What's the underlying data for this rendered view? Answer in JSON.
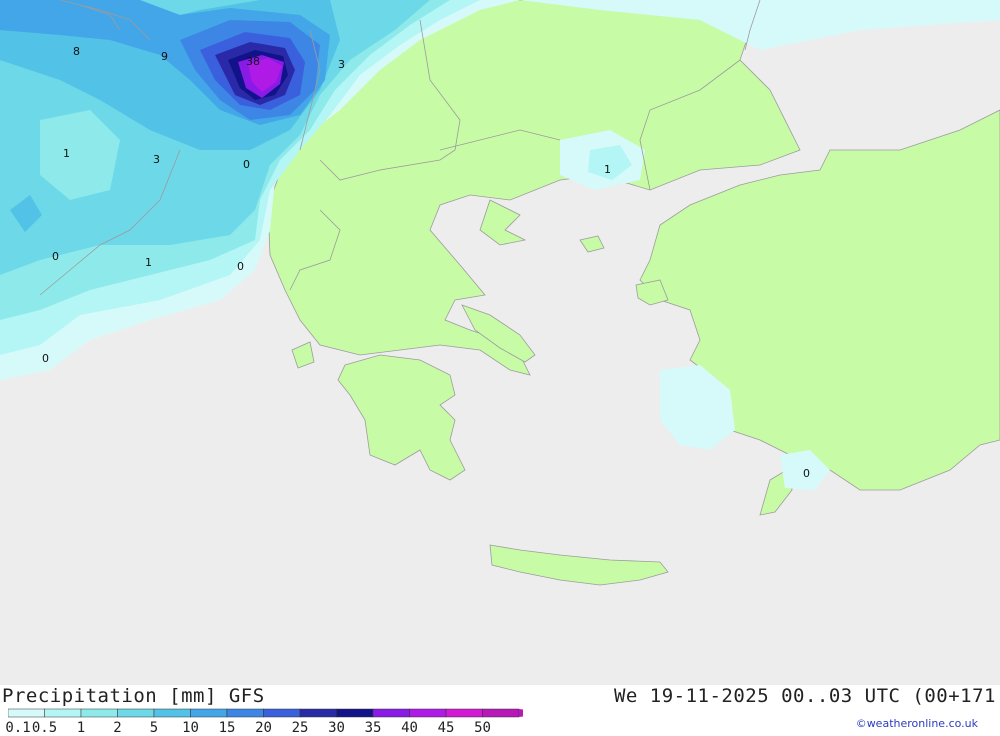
{
  "header": {
    "title": "Precipitation [mm] GFS",
    "datetime": "We 19-11-2025 00..03 UTC (00+171",
    "credit": "©weatheronline.co.uk"
  },
  "legend": {
    "labels": [
      "0.1",
      "0.5",
      "1",
      "2",
      "5",
      "10",
      "15",
      "20",
      "25",
      "30",
      "35",
      "40",
      "45",
      "50"
    ],
    "colors": [
      "#d6fafa",
      "#b4f5f5",
      "#8eeaea",
      "#6cd8e8",
      "#52c2e6",
      "#43a6e8",
      "#3d86e6",
      "#3b60dd",
      "#2a2aa8",
      "#12128a",
      "#8a1ae6",
      "#b01ae6",
      "#d21ad6",
      "#b818b8"
    ]
  },
  "map": {
    "colors": {
      "sea": "#ededed",
      "land": "#c8fba6",
      "border": "#9c9c9c"
    },
    "value_labels": [
      "8",
      "9",
      "38",
      "3",
      "1",
      "3",
      "0",
      "0",
      "1",
      "0",
      "0",
      "1",
      "0"
    ]
  }
}
